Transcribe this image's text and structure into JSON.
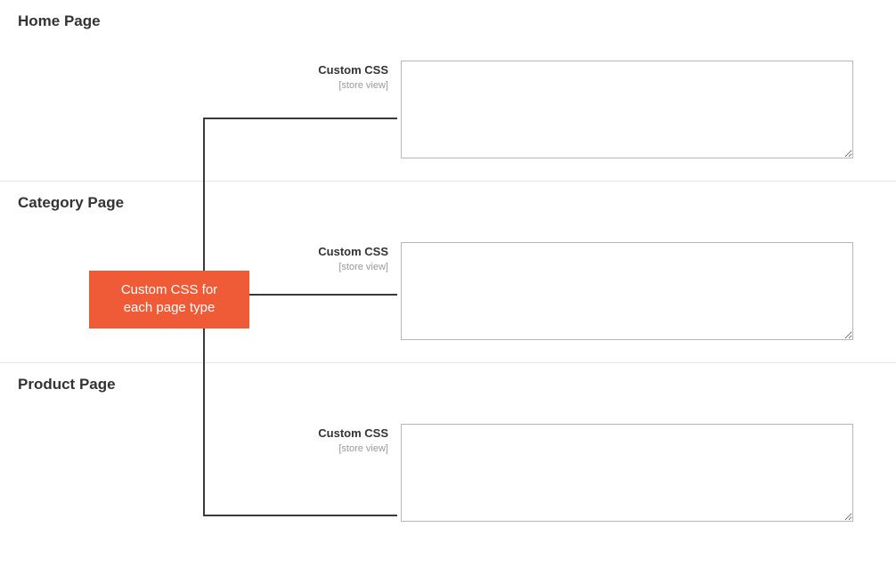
{
  "callout": {
    "line1": "Custom CSS for",
    "line2": "each page type"
  },
  "sections": [
    {
      "title": "Home Page",
      "field_label": "Custom CSS",
      "field_scope": "[store view]",
      "field_value": ""
    },
    {
      "title": "Category Page",
      "field_label": "Custom CSS",
      "field_scope": "[store view]",
      "field_value": ""
    },
    {
      "title": "Product Page",
      "field_label": "Custom CSS",
      "field_scope": "[store view]",
      "field_value": ""
    }
  ]
}
